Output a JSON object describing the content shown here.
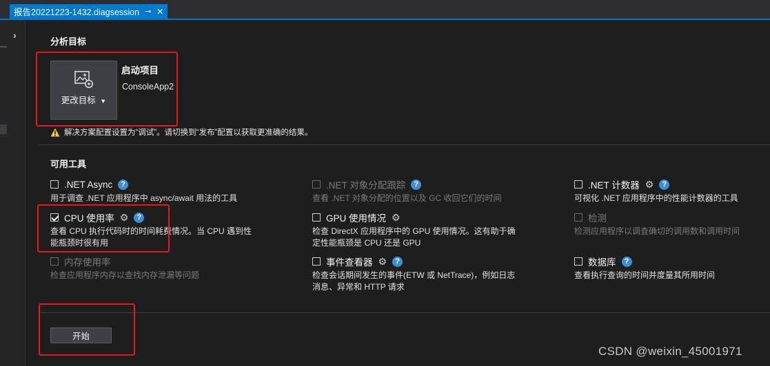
{
  "tab": {
    "title": "报告20221223-1432.diagsession",
    "pin_glyph": "⊸",
    "close_glyph": "✕"
  },
  "target_section": {
    "title": "分析目标",
    "change_target_label": "更改目标",
    "startup_project_label": "启动项目",
    "project_name": "ConsoleApp2"
  },
  "warning": {
    "text": "解决方案配置设置为“调试”。请切换到“发布”配置以获取更准确的结果。"
  },
  "tools_section": {
    "title": "可用工具",
    "tools": [
      {
        "name": ".NET Async",
        "desc": "用于调查 .NET 应用程序中 async/await 用法的工具",
        "checked": false,
        "disabled": false,
        "gear": false,
        "help": true
      },
      {
        "name": ".NET 对象分配跟踪",
        "desc": "查看 .NET 对象分配的位置以及 GC 收回它们的时间",
        "checked": false,
        "disabled": true,
        "gear": false,
        "help": true
      },
      {
        "name": ".NET 计数器",
        "desc": "可视化 .NET 应用程序中的性能计数器的工具",
        "checked": false,
        "disabled": false,
        "gear": true,
        "help": true
      },
      {
        "name": "CPU 使用率",
        "desc": "查看 CPU 执行代码时的时间耗费情况。当 CPU 遇到性能瓶颈时很有用",
        "checked": true,
        "disabled": false,
        "gear": true,
        "help": true
      },
      {
        "name": "GPU 使用情况",
        "desc": "检查 DirectX 应用程序中的 GPU 使用情况。这有助于确定性能瓶颈是 CPU 还是 GPU",
        "checked": false,
        "disabled": false,
        "gear": true,
        "help": false
      },
      {
        "name": "检测",
        "desc": "检测应用程序以调查确切的调用数和调用时间",
        "checked": false,
        "disabled": true,
        "gear": false,
        "help": false
      },
      {
        "name": "内存使用率",
        "desc": "检查应用程序内存以查找内存泄漏等问题",
        "checked": false,
        "disabled": true,
        "gear": false,
        "help": false
      },
      {
        "name": "事件查看器",
        "desc": "检查会话期间发生的事件(ETW 或 NetTrace)，例如日志消息、异常和 HTTP 请求",
        "checked": false,
        "disabled": false,
        "gear": true,
        "help": true
      },
      {
        "name": "数据库",
        "desc": "查看执行查询的时间并度量其所用时间",
        "checked": false,
        "disabled": false,
        "gear": false,
        "help": true
      }
    ]
  },
  "start_button": {
    "label": "开始"
  },
  "icons": {
    "gear": "⚙",
    "help": "?",
    "chevron": "›"
  },
  "watermark": "CSDN @weixin_45001971",
  "colors": {
    "accent": "#007acc",
    "highlight_box": "#e81b1b",
    "warning": "#f2c744"
  }
}
